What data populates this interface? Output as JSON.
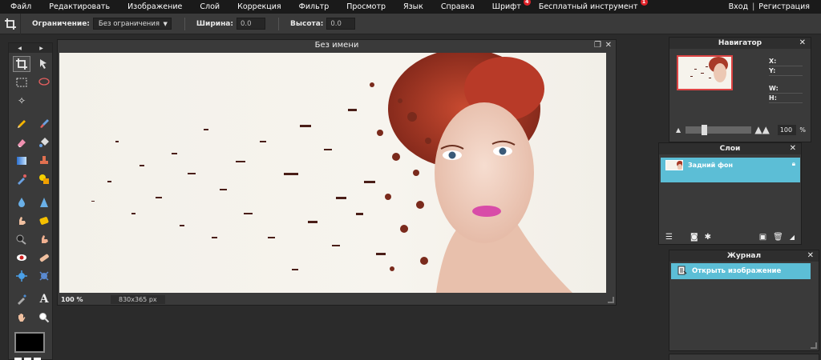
{
  "menu": {
    "items": [
      {
        "label": "Файл"
      },
      {
        "label": "Редактировать"
      },
      {
        "label": "Изображение"
      },
      {
        "label": "Слой"
      },
      {
        "label": "Коррекция"
      },
      {
        "label": "Фильтр"
      },
      {
        "label": "Просмотр"
      },
      {
        "label": "Язык"
      },
      {
        "label": "Справка"
      },
      {
        "label": "Шрифт",
        "badge": "4"
      },
      {
        "label": "Бесплатный инструмент",
        "badge": "1"
      }
    ],
    "login": "Вход",
    "separator": "|",
    "register": "Регистрация"
  },
  "options": {
    "constraint_label": "Ограничение:",
    "constraint_value": "Без ограничения",
    "width_label": "Ширина:",
    "width_value": "0.0",
    "height_label": "Высота:",
    "height_value": "0.0"
  },
  "canvas_window": {
    "title": "Без имени",
    "zoom": "100",
    "zoom_unit": "%",
    "size": "830x365 px"
  },
  "navigator": {
    "title": "Навигатор",
    "x_label": "X:",
    "y_label": "Y:",
    "w_label": "W:",
    "h_label": "H:",
    "zoom_value": "100",
    "zoom_unit": "%"
  },
  "layers": {
    "title": "Слои",
    "items": [
      {
        "name": "Задний фон",
        "locked": true
      }
    ]
  },
  "history": {
    "title": "Журнал",
    "items": [
      {
        "label": "Открыть изображение"
      }
    ]
  },
  "colors": {
    "menu_bg": "#1a1a1a",
    "panel_bg": "#3a3a3a",
    "workspace_bg": "#2b2b2b",
    "selection": "#5cbed6",
    "badge": "#e0232a",
    "foreground_color": "#000000"
  }
}
